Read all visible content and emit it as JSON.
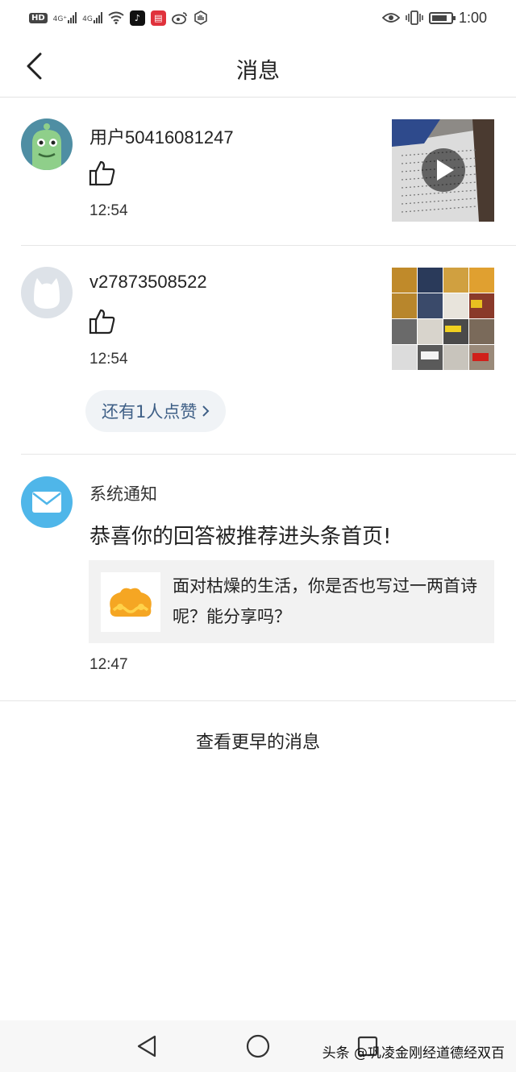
{
  "status_bar": {
    "hd_badge": "HD",
    "signal1_label": "4G⁺",
    "signal2_label": "4G",
    "time": "1:00"
  },
  "header": {
    "title": "消息",
    "back_icon": "chevron-left-icon"
  },
  "notifications": [
    {
      "username": "用户50416081247",
      "action_icon": "thumbs-up-icon",
      "time": "12:54",
      "thumbnail": "video-thumbnail-calligraphy",
      "is_video": true
    },
    {
      "username": "v27873508522",
      "action_icon": "thumbs-up-icon",
      "time": "12:54",
      "thumbnail": "photo-grid-thumbnail",
      "more_likes_label": "还有1人点赞"
    }
  ],
  "system_notice": {
    "title": "系统通知",
    "headline": "恭喜你的回答被推荐进头条首页!",
    "card_text": "面对枯燥的生活，你是否也写过一两首诗呢？能分享吗？",
    "time": "12:47",
    "icon": "envelope-icon"
  },
  "earlier_label": "查看更早的消息",
  "watermark": "头条 @巩凌金刚经道德经双百",
  "colors": {
    "link_blue": "#3e5f86",
    "mail_blue": "#4fb6e9",
    "logo_orange": "#f5a623"
  }
}
